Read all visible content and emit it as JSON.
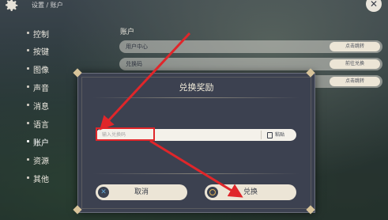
{
  "breadcrumb": "设置 / 账户",
  "sidebar": {
    "items": [
      {
        "label": "控制"
      },
      {
        "label": "按键"
      },
      {
        "label": "图像"
      },
      {
        "label": "声音"
      },
      {
        "label": "消息"
      },
      {
        "label": "语言"
      },
      {
        "label": "账户"
      },
      {
        "label": "资源"
      },
      {
        "label": "其他"
      }
    ],
    "active": "账户"
  },
  "account": {
    "section_title": "账户",
    "rows": [
      {
        "label": "用户中心",
        "action": "点击跳转"
      },
      {
        "label": "兑换码",
        "action": "前往兑换"
      },
      {
        "label": "",
        "action": "点击跳转"
      }
    ]
  },
  "modal": {
    "title": "兑换奖励",
    "input_placeholder": "输入兑换码",
    "paste_label": "粘贴",
    "cancel_label": "取消",
    "confirm_label": "兑换"
  },
  "colors": {
    "annotation": "#e0262a",
    "modal_bg": "#3c4150",
    "button_bg": "#ece5d6"
  }
}
